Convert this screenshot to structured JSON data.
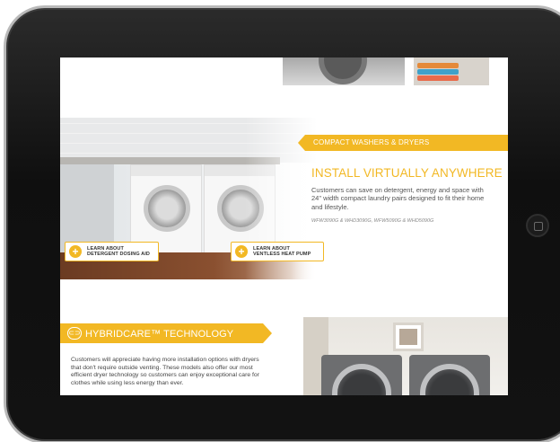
{
  "compact": {
    "banner": "COMPACT WASHERS & DRYERS",
    "headline": "INSTALL VIRTUALLY ANYWHERE",
    "body": "Customers can save on detergent, energy and space with 24\" width compact laundry pairs designed to fit their home and lifestyle.",
    "models": "WFW3090G & WHD3090G, WFW5090G & WHD5090G"
  },
  "buttons": {
    "dosing_line1": "LEARN ABOUT",
    "dosing_line2": "DETERGENT DOSING AID",
    "heatpump_line1": "LEARN ABOUT",
    "heatpump_line2": "VENTLESS HEAT PUMP"
  },
  "hybridcare": {
    "title": "HYBRIDCARE™ TECHNOLOGY",
    "body": "Customers will appreciate having more installation options with dryers that don't require outside venting. These models also offer our most efficient dryer technology so customers can enjoy exceptional care for clothes while using less energy than ever."
  },
  "colors": {
    "accent": "#f2b824",
    "bezel": "#111111"
  },
  "icons": {
    "plus": "plus-circle-icon",
    "hybrid": "hybridcare-logo-icon"
  }
}
